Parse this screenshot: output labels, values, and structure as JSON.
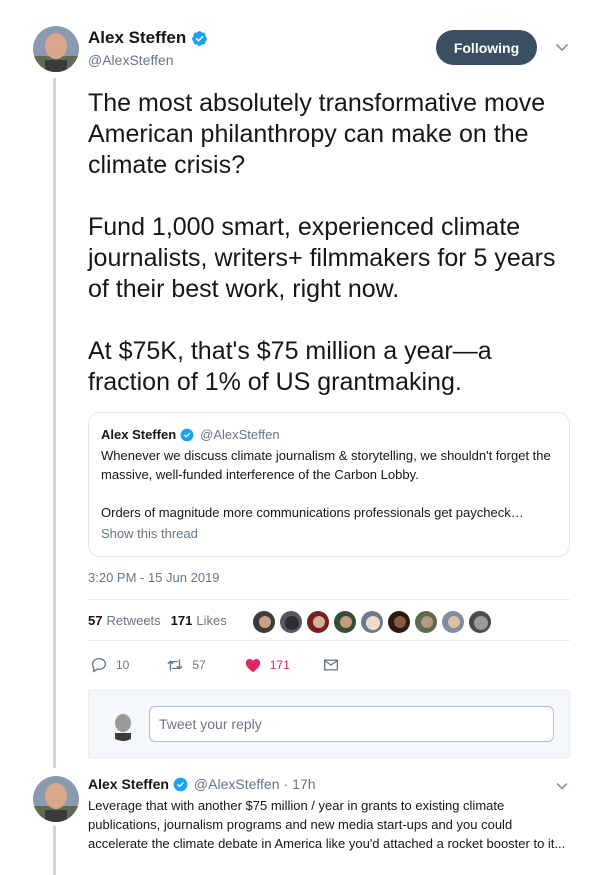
{
  "tweet": {
    "display_name": "Alex Steffen",
    "handle": "@AlexSteffen",
    "follow_label": "Following",
    "paragraphs": [
      "The most absolutely transformative move American philanthropy can make on the climate crisis?",
      "Fund 1,000 smart, experienced climate journalists, writers+ filmmakers for 5 years of their best work, right now.",
      "At $75K, that's $75 million a year—a fraction of 1% of US grantmaking."
    ],
    "timestamp": "3:20 PM - 15 Jun 2019",
    "retweets_count": "57",
    "retweets_label": "Retweets",
    "likes_count": "171",
    "likes_label": "Likes",
    "actions": {
      "reply_count": "10",
      "retweet_count": "57",
      "like_count": "171"
    }
  },
  "quote": {
    "display_name": "Alex Steffen",
    "handle": "@AlexSteffen",
    "paragraphs": [
      "Whenever we discuss climate journalism & storytelling, we shouldn't forget the massive, well-funded interference of the Carbon Lobby.",
      "Orders of magnitude more communications professionals get paycheck…"
    ],
    "show_thread": "Show this thread"
  },
  "reply_box": {
    "placeholder": "Tweet your reply"
  },
  "next_tweet": {
    "display_name": "Alex Steffen",
    "handle": "@AlexSteffen",
    "separator": "·",
    "time": "17h",
    "text": "Leverage that with another $75 million / year in grants to existing climate publications, journalism programs and new media start-ups and you could accelerate the climate debate in America like you'd attached a rocket booster to it..."
  },
  "colors": {
    "follow_button": "#3b4f62",
    "verified": "#1da1f2",
    "like": "#e0245e",
    "muted": "#657786"
  },
  "icons": [
    "verified-badge-icon",
    "chevron-down-icon",
    "reply-icon",
    "retweet-icon",
    "heart-icon",
    "message-icon"
  ]
}
